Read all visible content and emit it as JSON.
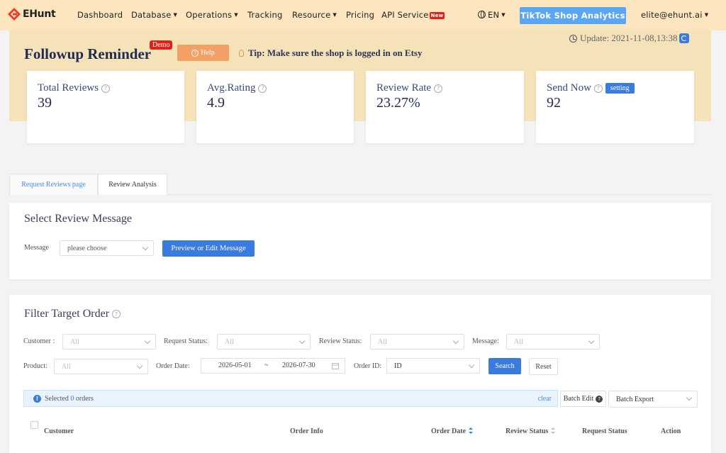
{
  "nav": {
    "logo_text": "EHunt",
    "items": [
      {
        "label": "Dashboard"
      },
      {
        "label": "Database"
      },
      {
        "label": "Operations"
      },
      {
        "label": "Tracking"
      },
      {
        "label": "Resource"
      },
      {
        "label": "Pricing"
      },
      {
        "label": "API Service"
      }
    ],
    "new_badge": "New",
    "language": "EN",
    "tiktok_button": "TikTok Shop Analytics",
    "user_email": "elite@ehunt.ai"
  },
  "header": {
    "update_text": "Update: 2021-11-08,13:38",
    "title": "Followup Reminder",
    "demo_badge": "Demo",
    "help_label": "Help",
    "tip": "Tip: Make sure the shop is logged in on Etsy"
  },
  "stats": [
    {
      "label": "Total Reviews",
      "value": "39"
    },
    {
      "label": "Avg.Rating",
      "value": "4.9"
    },
    {
      "label": "Review Rate",
      "value": "23.27%"
    },
    {
      "label": "Send Now",
      "value": "92",
      "badge": "setting"
    }
  ],
  "tabs": [
    {
      "label": "Request Reviews page"
    },
    {
      "label": "Review Analysis"
    }
  ],
  "message_card": {
    "title": "Select Review Message",
    "message_label": "Message",
    "message_placeholder": "please choose",
    "preview_button": "Preview or Edit Message"
  },
  "filter_card": {
    "title": "Filter Target Order",
    "customer_label": "Customer :",
    "customer_value": "All",
    "request_status_label": "Request Status:",
    "request_status_value": "All",
    "review_status_label": "Review Status:",
    "review_status_value": "All",
    "message_label": "Message:",
    "message_value": "All",
    "product_label": "Product:",
    "product_value": "All",
    "order_date_label": "Order Date:",
    "date_start": "2026-05-01",
    "date_sep": "~",
    "date_end": "2026-07-30",
    "order_id_label": "Order ID:",
    "order_id_value": "ID",
    "search_button": "Search",
    "reset_button": "Reset",
    "selected_prefix": "Selected",
    "selected_count": "0",
    "selected_suffix": "orders",
    "clear_link": "clear",
    "batch_edit": "Batch Edit",
    "batch_export": "Batch Export"
  },
  "table": {
    "headers": [
      "Customer",
      "Order Info",
      "Order Date",
      "Review Status",
      "Request Status",
      "Action"
    ]
  },
  "colors": {
    "accent": "#3a7be0",
    "nav_bg": "#fde6bf",
    "hero_bg": "#f6e2b9",
    "help_orange": "#f3a066",
    "badge_red": "#e0221b"
  }
}
